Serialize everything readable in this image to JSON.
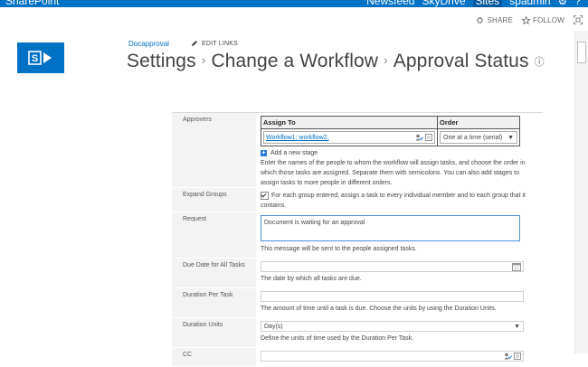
{
  "suitebar": {
    "brand": "SharePoint",
    "links": [
      "Newsfeed",
      "SkyDrive",
      "Sites",
      "spadmin"
    ],
    "active_link": "Sites"
  },
  "actions": {
    "share": "SHARE",
    "follow": "FOLLOW"
  },
  "site": {
    "name": "Docapproval",
    "edit_links": "EDIT LINKS",
    "logo_glyph": "S"
  },
  "title": {
    "part1": "Settings",
    "part2": "Change a Workflow",
    "part3": "Approval Status",
    "separator": "›",
    "info_glyph": "ⓘ"
  },
  "form": {
    "approvers": {
      "label": "Approvers",
      "col_assign": "Assign To",
      "col_order": "Order",
      "assignees": "Workflow1; workflow2;",
      "order_value": "One at a time (serial)",
      "add_stage": "Add a new stage",
      "description": "Enter the names of the people to whom the workflow will assign tasks, and choose the order in which those tasks are assigned. Separate them with semicolons. You can also add stages to assign tasks to more people in different orders."
    },
    "expand_groups": {
      "label": "Expand Groups",
      "checked": true,
      "text": "For each group entered, assign a task to every individual member and to each group that it contains."
    },
    "request": {
      "label": "Request",
      "value": "Document is waiting for an approval",
      "description": "This message will be sent to the people assigned tasks."
    },
    "due_date": {
      "label": "Due Date for All Tasks",
      "value": "",
      "description": "The date by which all tasks are due."
    },
    "duration_per_task": {
      "label": "Duration Per Task",
      "value": "",
      "description": "The amount of time until a task is due. Choose the units by using the Duration Units."
    },
    "duration_units": {
      "label": "Duration Units",
      "value": "Day(s)",
      "description": "Define the units of time used by the Duration Per Task."
    },
    "cc": {
      "label": "CC",
      "value": ""
    }
  },
  "colors": {
    "suite_blue": "#0072c6",
    "link_blue": "#0072c6",
    "row_bg": "#f3f3f3"
  }
}
